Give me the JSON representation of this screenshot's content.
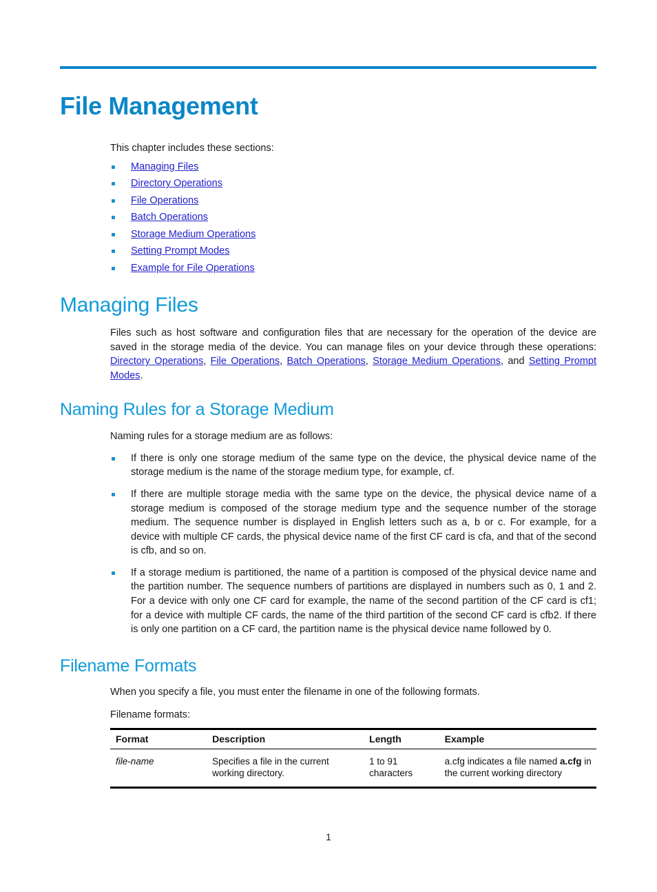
{
  "document": {
    "chapter_title": "File Management",
    "page_number": "1",
    "accent_color": "#0b86c8",
    "heading_color": "#129bd8",
    "link_color": "#2222cc",
    "bullet_color": "#1a8fd0"
  },
  "intro": {
    "lead": "This chapter includes these sections:",
    "links": [
      "Managing Files",
      "Directory Operations",
      "File Operations",
      "Batch Operations",
      "Storage Medium Operations",
      "Setting Prompt Modes",
      "Example for File Operations"
    ]
  },
  "managing_files": {
    "heading": "Managing Files",
    "paragraph_part1": "Files such as host software and configuration files that are necessary for the operation of the device are saved in the storage media of the device. You can manage files on your device through these operations: ",
    "link1": "Directory Operations",
    "sep1": ", ",
    "link2": "File Operations",
    "sep2": ", ",
    "link3": "Batch Operations",
    "sep3": ", ",
    "link4": "Storage Medium Operations",
    "sep4": ", and ",
    "link5": "Setting Prompt Modes",
    "paragraph_end": "."
  },
  "naming_rules": {
    "heading": "Naming Rules for a Storage Medium",
    "lead": "Naming rules for a storage medium are as follows:",
    "items": [
      "If there is only one storage medium of the same type on the device, the physical device name of the storage medium is the name of the storage medium type, for example, cf.",
      "If there are multiple storage media with the same type on the device, the physical device name of a storage medium is composed of the storage medium type and the sequence number of the storage medium. The sequence number is displayed in English letters such as a, b or c. For example, for a device with multiple CF cards, the physical device name of the first CF card is cfa, and that of the second is cfb, and so on.",
      "If a storage medium is partitioned, the name of a partition is composed of the physical device name and the partition number. The sequence numbers of partitions are displayed in numbers such as 0, 1 and 2. For a device with only one CF card for example, the name of the second partition of the CF card is cf1; for a device with multiple CF cards, the name of the third partition of the second CF card is cfb2. If there is only one partition on a CF card, the partition name is the physical device name followed by 0."
    ]
  },
  "filename_formats": {
    "heading": "Filename Formats",
    "lead": "When you specify a file, you must enter the filename in one of the following formats.",
    "table_caption": "Filename formats:",
    "table": {
      "headers": [
        "Format",
        "Description",
        "Length",
        "Example"
      ],
      "rows": [
        {
          "format": "file-name",
          "description": "Specifies a file in the current working directory.",
          "length": "1 to 91 characters",
          "example_pre": "a.cfg indicates a file named ",
          "example_bold": "a.cfg",
          "example_post": " in the current working directory"
        }
      ]
    }
  }
}
